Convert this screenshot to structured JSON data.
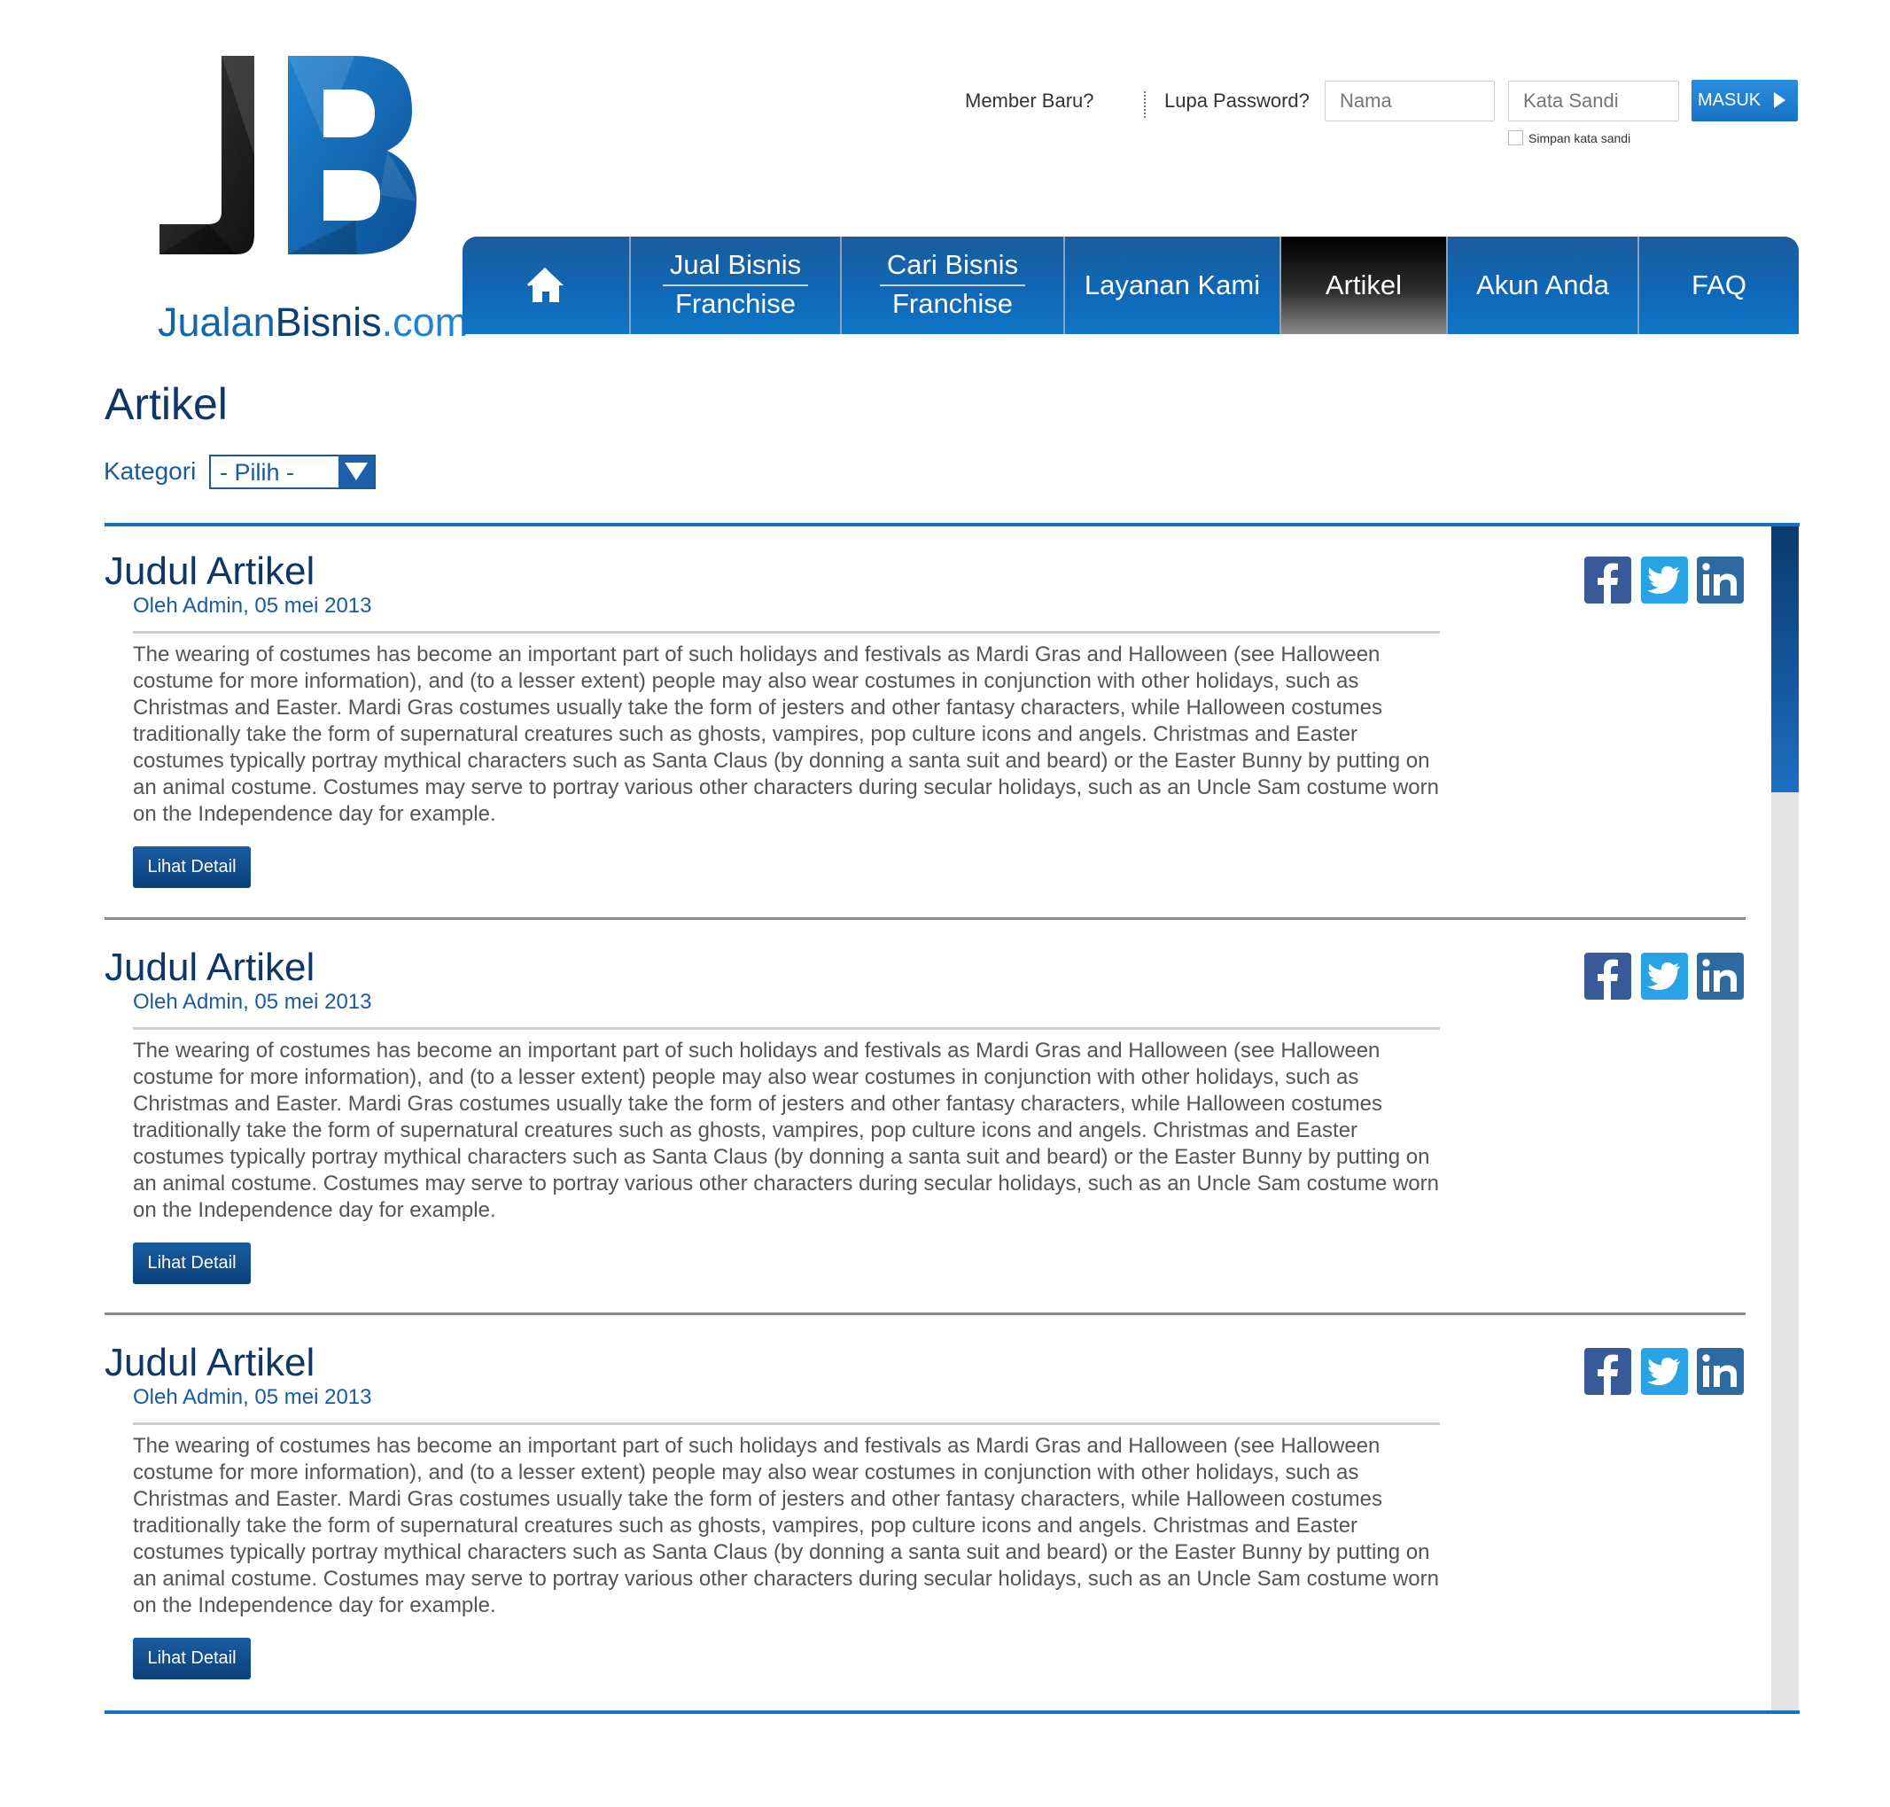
{
  "brand": {
    "logo_monogram": "JB",
    "logo_text_1": "Jualan",
    "logo_text_2": "Bisnis",
    "logo_text_3": ".com",
    "colors": {
      "primary": "#1565ad",
      "dark": "#0e3668",
      "accent": "#2a8ee0"
    }
  },
  "header": {
    "member_baru": "Member Baru?",
    "lupa_password": "Lupa Password?",
    "nama_placeholder": "Nama",
    "sandi_placeholder": "Kata Sandi",
    "masuk_label": "MASUK",
    "remember_label": "Simpan kata sandi"
  },
  "nav": {
    "home_icon": "home-icon",
    "items": [
      {
        "line1": "Jual Bisnis",
        "line2": "Franchise"
      },
      {
        "line1": "Cari Bisnis",
        "line2": "Franchise"
      },
      {
        "label": "Layanan Kami"
      },
      {
        "label": "Artikel",
        "active": true
      },
      {
        "label": "Akun Anda"
      },
      {
        "label": "FAQ"
      }
    ]
  },
  "page": {
    "title": "Artikel",
    "kategori_label": "Kategori",
    "kategori_value": "- Pilih -"
  },
  "articles": [
    {
      "title": "Judul Artikel",
      "meta": "Oleh Admin, 05 mei 2013",
      "body": "The wearing of costumes has become an important part of such holidays and festivals as Mardi Gras and Halloween (see Halloween costume for more information), and (to a lesser extent) people may also wear costumes in conjunction with other holidays, such as Christmas and Easter. Mardi Gras costumes usually take the form of jesters and other fantasy characters, while Halloween costumes traditionally take the form of supernatural creatures such as ghosts, vampires, pop culture icons and angels. Christmas and Easter costumes typically portray mythical characters such as Santa Claus (by donning a santa suit and beard) or the Easter Bunny by putting on an animal costume. Costumes may serve to portray various other characters during secular holidays, such as an Uncle Sam costume worn on the Independence day for example.",
      "button": "Lihat Detail"
    },
    {
      "title": "Judul Artikel",
      "meta": "Oleh Admin, 05 mei 2013",
      "body": "The wearing of costumes has become an important part of such holidays and festivals as Mardi Gras and Halloween (see Halloween costume for more information), and (to a lesser extent) people may also wear costumes in conjunction with other holidays, such as Christmas and Easter. Mardi Gras costumes usually take the form of jesters and other fantasy characters, while Halloween costumes traditionally take the form of supernatural creatures such as ghosts, vampires, pop culture icons and angels. Christmas and Easter costumes typically portray mythical characters such as Santa Claus (by donning a santa suit and beard) or the Easter Bunny by putting on an animal costume. Costumes may serve to portray various other characters during secular holidays, such as an Uncle Sam costume worn on the Independence day for example.",
      "button": "Lihat Detail"
    },
    {
      "title": "Judul Artikel",
      "meta": "Oleh Admin, 05 mei 2013",
      "body": "The wearing of costumes has become an important part of such holidays and festivals as Mardi Gras and Halloween (see Halloween costume for more information), and (to a lesser extent) people may also wear costumes in conjunction with other holidays, such as Christmas and Easter. Mardi Gras costumes usually take the form of jesters and other fantasy characters, while Halloween costumes traditionally take the form of supernatural creatures such as ghosts, vampires, pop culture icons and angels. Christmas and Easter costumes typically portray mythical characters such as Santa Claus (by donning a santa suit and beard) or the Easter Bunny by putting on an animal costume. Costumes may serve to portray various other characters during secular holidays, such as an Uncle Sam costume worn on the Independence day for example.",
      "button": "Lihat Detail"
    }
  ],
  "social_icons": [
    "facebook-icon",
    "twitter-icon",
    "linkedin-icon"
  ]
}
